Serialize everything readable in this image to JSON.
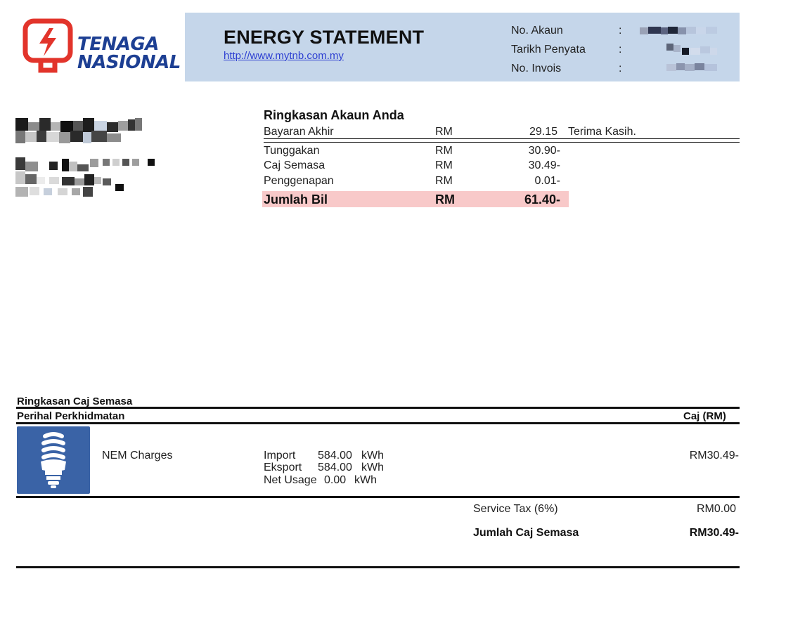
{
  "brand": {
    "logo_line1": "TENAGA",
    "logo_line2": "NASIONAL",
    "color_red": "#e2342b",
    "color_blue": "#1d3f93",
    "icon": "tnb-logo-icon"
  },
  "header": {
    "title": "ENERGY STATEMENT",
    "url": "http://www.mytnb.com.my",
    "band_color": "#c5d6ea",
    "fields": [
      {
        "label": "No. Akaun",
        "colon": ":"
      },
      {
        "label": "Tarikh Penyata",
        "colon": ":"
      },
      {
        "label": "No. Invois",
        "colon": ":"
      }
    ]
  },
  "summary": {
    "title": "Ringkasan Akaun Anda",
    "last_payment": {
      "label": "Bayaran Akhir",
      "currency": "RM",
      "amount": "29.15",
      "note": "Terima Kasih."
    },
    "rows": [
      {
        "label": "Tunggakan",
        "currency": "RM",
        "amount": "30.90-"
      },
      {
        "label": "Caj Semasa",
        "currency": "RM",
        "amount": "30.49-"
      },
      {
        "label": "Penggenapan",
        "currency": "RM",
        "amount": "0.01-"
      }
    ],
    "total": {
      "label": "Jumlah Bil",
      "currency": "RM",
      "amount": "61.40-"
    },
    "total_band_color": "#f8c9c9"
  },
  "charges": {
    "section_title": "Ringkasan Caj Semasa",
    "col_service": "Perihal Perkhidmatan",
    "col_charge": "Caj (RM)",
    "item": {
      "icon": "energy-saving-bulb-icon",
      "name": "NEM Charges",
      "import_label": "Import",
      "import_value": "584.00",
      "export_label": "Eksport",
      "export_value": "584.00",
      "net_label": "Net Usage",
      "net_value": "0.00",
      "unit": "kWh",
      "amount": "RM30.49-"
    },
    "service_tax": {
      "label": "Service Tax (6%)",
      "amount": "RM0.00"
    },
    "total": {
      "label": "Jumlah Caj Semasa",
      "amount": "RM30.49-"
    }
  }
}
